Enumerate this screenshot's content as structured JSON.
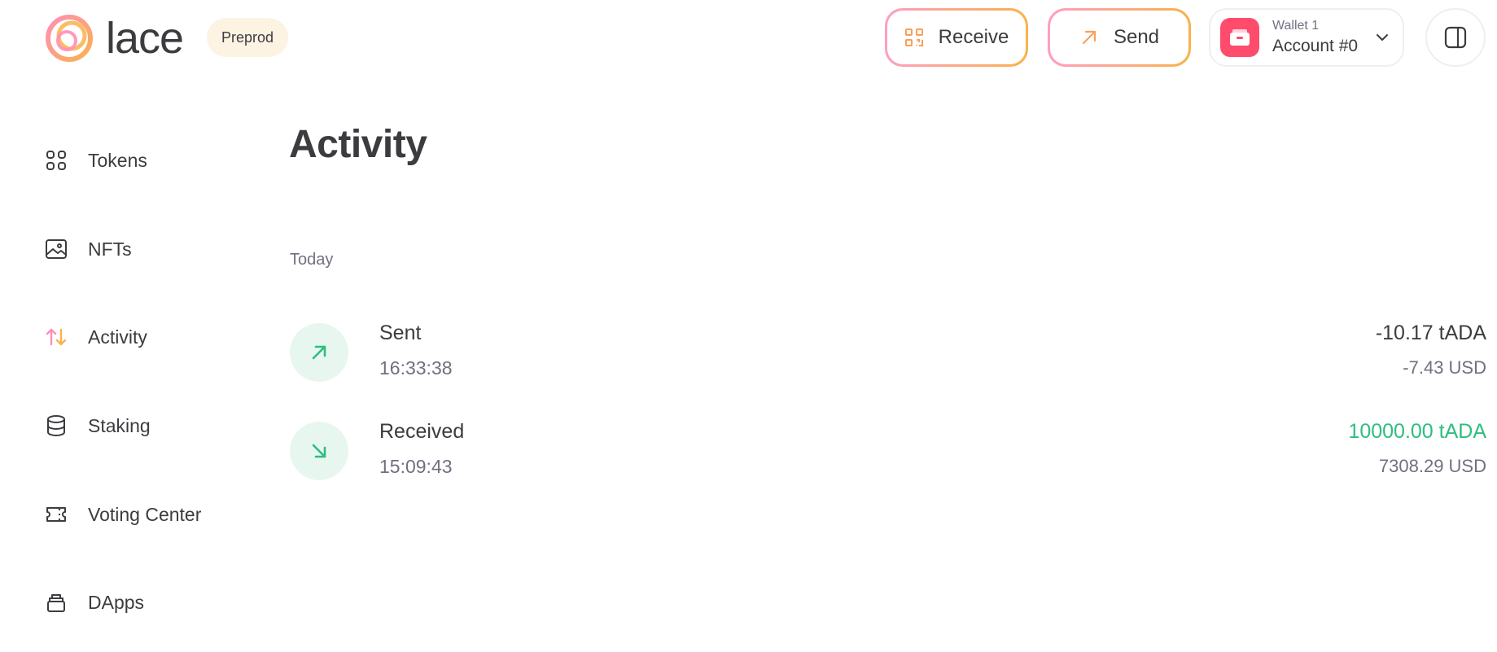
{
  "header": {
    "logo_text": "lace",
    "network_badge": "Preprod",
    "receive_label": "Receive",
    "send_label": "Send",
    "wallet": {
      "name": "Wallet 1",
      "account": "Account #0"
    }
  },
  "sidebar": {
    "items": [
      {
        "label": "Tokens",
        "icon": "grid-icon",
        "active": false
      },
      {
        "label": "NFTs",
        "icon": "image-icon",
        "active": false
      },
      {
        "label": "Activity",
        "icon": "arrows-up-down-icon",
        "active": true
      },
      {
        "label": "Staking",
        "icon": "database-icon",
        "active": false
      },
      {
        "label": "Voting Center",
        "icon": "ticket-icon",
        "active": false
      },
      {
        "label": "DApps",
        "icon": "stack-icon",
        "active": false
      }
    ]
  },
  "main": {
    "title": "Activity",
    "groups": [
      {
        "label": "Today",
        "transactions": [
          {
            "type": "Sent",
            "time": "16:33:38",
            "amount": "-10.17 tADA",
            "usd": "-7.43 USD",
            "direction": "out",
            "amount_color": "#3d3b3f"
          },
          {
            "type": "Received",
            "time": "15:09:43",
            "amount": "10000.00 tADA",
            "usd": "7308.29 USD",
            "direction": "in",
            "amount_color": "#2ebd80"
          }
        ]
      }
    ]
  },
  "colors": {
    "accent_pink": "#ff9ec0",
    "accent_orange": "#f9b24c",
    "wallet_red": "#ff4c6d",
    "success_green": "#2ebd80",
    "tx_icon_bg": "#e7f7f0"
  }
}
